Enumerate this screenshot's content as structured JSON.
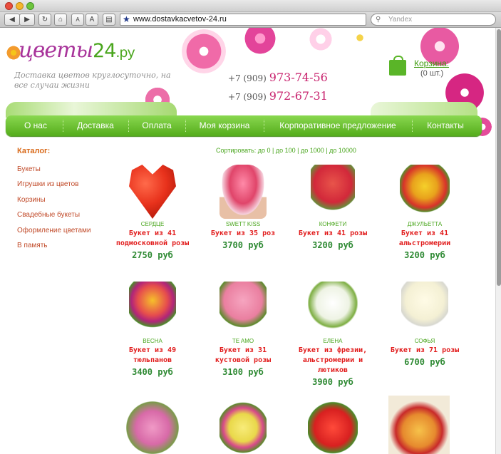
{
  "browser": {
    "url": "www.dostavkacvetov-24.ru",
    "search_placeholder": "Yandex"
  },
  "header": {
    "logo_word": "цветы",
    "logo_num": "24",
    "logo_domain": ".ру",
    "tagline": "Доставка цветов круглосуточно, на все случаи жизни",
    "phones": [
      {
        "prefix": "+7 (909)",
        "number": "973-74-56"
      },
      {
        "prefix": "+7 (909)",
        "number": "972-67-31"
      }
    ],
    "cart_label": "Корзина:",
    "cart_count": "(0 шт.)"
  },
  "nav": [
    "О нас",
    "Доставка",
    "Оплата",
    "Моя корзина",
    "Корпоративное предложение",
    "Контакты"
  ],
  "catalog": {
    "title": "Каталог:",
    "items": [
      "Букеты",
      "Игрушки из цветов",
      "Корзины",
      "Свадебные букеты",
      "Оформление цветами",
      "В память"
    ]
  },
  "sort_text": "Сортировать: до 0 | до 100 | до 1000 | до 10000",
  "products": [
    {
      "name": "Сердце",
      "desc": "Букет из 41 подмосковной розы",
      "price": "2750 руб",
      "color": "#e8321c"
    },
    {
      "name": "Swett Kiss",
      "desc": "Букет из 35 роз",
      "price": "3700 руб",
      "color": "#e0456a"
    },
    {
      "name": "Конфети",
      "desc": "Букет из 41 розы",
      "price": "3200 руб",
      "color": "#d2283a"
    },
    {
      "name": "Джульетта",
      "desc": "Букет из 41 альстромерии",
      "price": "3200 руб",
      "color": "#e8a21c"
    },
    {
      "name": "Весна",
      "desc": "Букет из 49 тюльпанов",
      "price": "3400 руб",
      "color": "#e64d4d"
    },
    {
      "name": "Te Amo",
      "desc": "Букет из 31 кустовой розы",
      "price": "3100 руб",
      "color": "#ea7fa0"
    },
    {
      "name": "Елена",
      "desc": "Букет из фрезии, альстромерии и лютиков",
      "price": "3900 руб",
      "color": "#eef3e4"
    },
    {
      "name": "Софья",
      "desc": "Букет из 71 розы",
      "price": "6700 руб",
      "color": "#f4f0d4"
    },
    {
      "name": "",
      "desc": "",
      "price": "",
      "color": "#d86aa8"
    },
    {
      "name": "",
      "desc": "",
      "price": "",
      "color": "#e9d84a"
    },
    {
      "name": "",
      "desc": "",
      "price": "",
      "color": "#d82020"
    },
    {
      "name": "",
      "desc": "",
      "price": "",
      "color": "#e68a2e"
    }
  ]
}
